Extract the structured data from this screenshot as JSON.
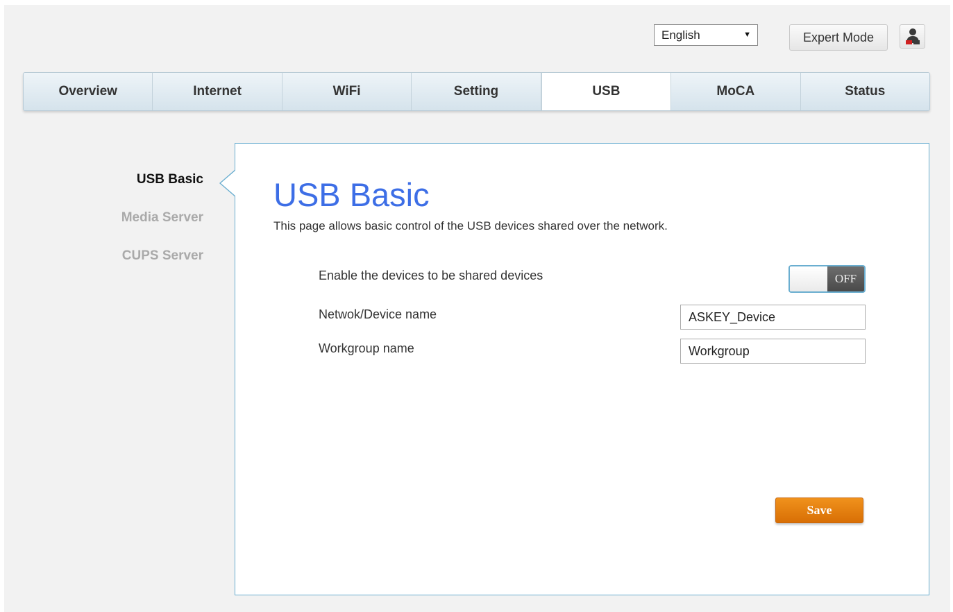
{
  "header": {
    "language": "English",
    "language_arrow": "▼",
    "expert_mode_label": "Expert Mode"
  },
  "nav": {
    "tabs": [
      {
        "label": "Overview"
      },
      {
        "label": "Internet"
      },
      {
        "label": "WiFi"
      },
      {
        "label": "Setting"
      },
      {
        "label": "USB",
        "active": true
      },
      {
        "label": "MoCA"
      },
      {
        "label": "Status"
      }
    ]
  },
  "sidebar": {
    "items": [
      {
        "label": "USB Basic",
        "active": true
      },
      {
        "label": "Media Server"
      },
      {
        "label": "CUPS Server"
      }
    ]
  },
  "main": {
    "title": "USB Basic",
    "description": "This page allows basic control of the USB devices shared over the network.",
    "share_label": "Enable the devices to be shared devices",
    "share_state": "OFF",
    "device_name_label": "Netwok/Device name",
    "device_name_value": "ASKEY_Device",
    "workgroup_label": "Workgroup name",
    "workgroup_value": "Workgroup",
    "save_label": "Save"
  },
  "colors": {
    "accent_blue": "#3d6ee6",
    "panel_border": "#6aaed0",
    "save_orange": "#e57f10"
  }
}
